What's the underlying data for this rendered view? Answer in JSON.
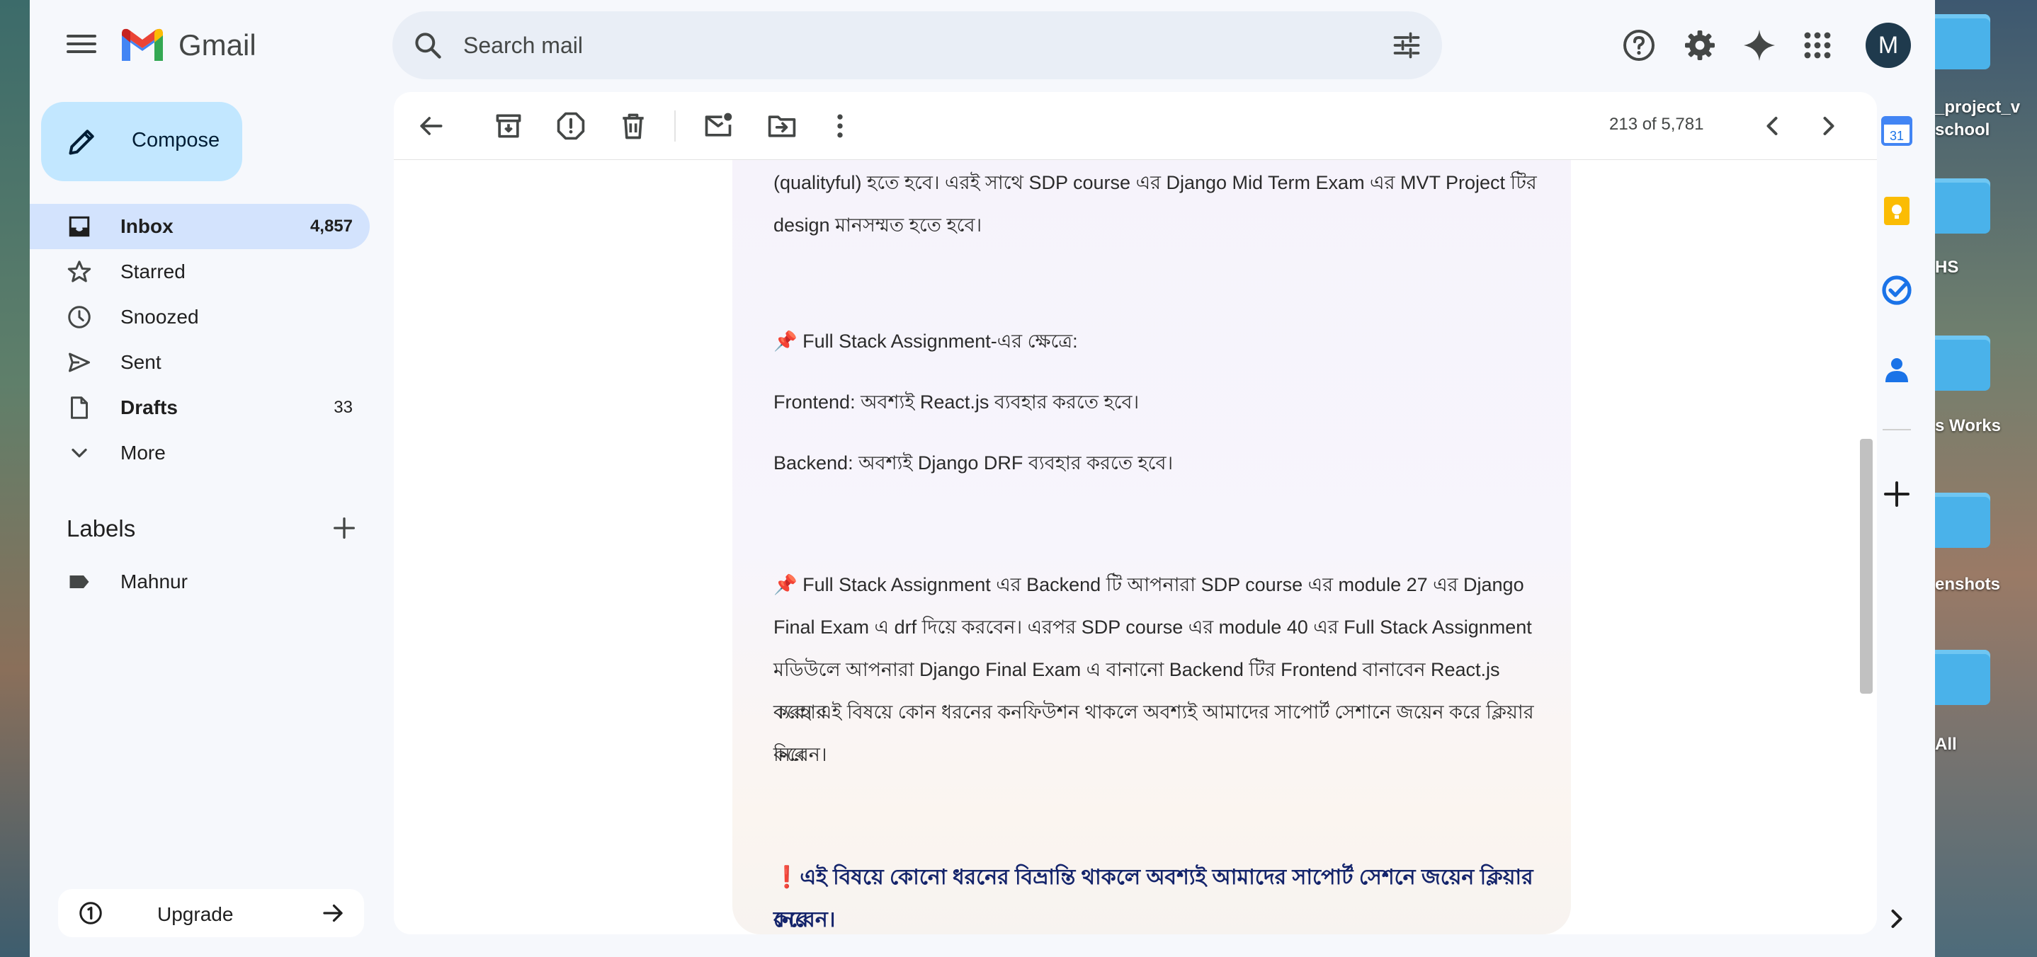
{
  "app": {
    "name": "Gmail",
    "brand_colors": {
      "red": "#ea4335",
      "blue": "#4285f4",
      "green": "#34a853",
      "yellow": "#fbbc04"
    }
  },
  "search": {
    "placeholder": "Search mail"
  },
  "user": {
    "avatar_letter": "M"
  },
  "sidebar": {
    "compose_label": "Compose",
    "items": [
      {
        "label": "Inbox",
        "count": "4,857",
        "icon": "inbox-icon",
        "active": true,
        "bold": true
      },
      {
        "label": "Starred",
        "count": "",
        "icon": "star-icon"
      },
      {
        "label": "Snoozed",
        "count": "",
        "icon": "clock-icon"
      },
      {
        "label": "Sent",
        "count": "",
        "icon": "send-icon"
      },
      {
        "label": "Drafts",
        "count": "33",
        "icon": "draft-icon",
        "bold": true
      },
      {
        "label": "More",
        "count": "",
        "icon": "chevron-down-icon"
      }
    ],
    "labels_title": "Labels",
    "labels": [
      {
        "label": "Mahnur",
        "icon": "label-icon"
      }
    ],
    "upgrade_label": "Upgrade"
  },
  "toolbar": {
    "pager": "213 of 5,781"
  },
  "email": {
    "p1": "(qualityful) হতে হবে। এরই সাথে SDP course এর Django Mid Term Exam এর MVT Project টির",
    "p1b": "design মানসম্মত হতে হবে।",
    "p2": "📌 Full Stack Assignment-এর ক্ষেত্রে:",
    "p3": "Frontend: অবশ্যই React.js ব্যবহার করতে হবে।",
    "p4": "Backend: অবশ্যই Django DRF ব্যবহার করতে হবে।",
    "p5_1": "📌 Full Stack Assignment এর Backend টি আপনারা SDP course এর module 27 এর Django",
    "p5_2": "Final Exam এ drf দিয়ে করবেন। এরপর SDP course এর module 40 এর Full Stack Assignment",
    "p5_3": "মডিউলে আপনারা Django Final Exam এ বানানো Backend টির Frontend বানাবেন React.js ব্যবহার",
    "p5_4": "করে। এই বিষয়ে কোন ধরনের কনফিউশন থাকলে অবশ্যই আমাদের সাপোর্ট সেশানে জয়েন করে ক্লিয়ার করে",
    "p5_5": "নিবেন।",
    "warn_1": "❗এই বিষয়ে কোনো ধরনের বিভ্রান্তি থাকলে অবশ্যই আমাদের সাপোর্ট সেশনে জয়েন ক্লিয়ার করে",
    "warn_2": "নেবেন।"
  },
  "desktop": {
    "items": [
      {
        "label": "_project_v\nschool"
      },
      {
        "label": "HS"
      },
      {
        "label": "s Works"
      },
      {
        "label": "enshots"
      },
      {
        "label": "All"
      }
    ]
  },
  "rail": {
    "calendar_day": "31"
  }
}
